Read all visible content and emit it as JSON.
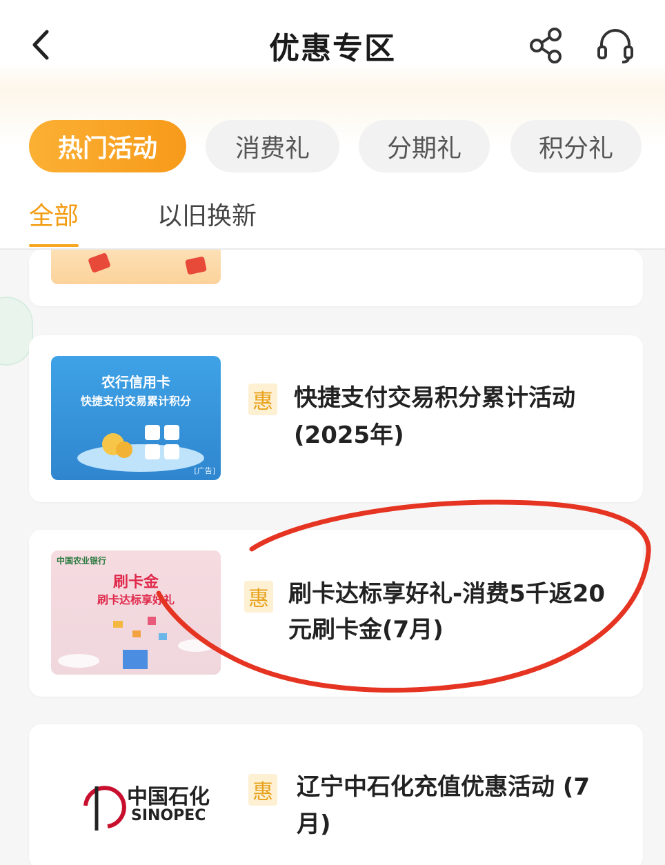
{
  "header": {
    "title": "优惠专区",
    "back_icon": "chevron-left-icon",
    "share_icon": "share-icon",
    "service_icon": "headset-icon"
  },
  "categories": [
    {
      "label": "热门活动",
      "active": true
    },
    {
      "label": "消费礼",
      "active": false
    },
    {
      "label": "分期礼",
      "active": false
    },
    {
      "label": "积分礼",
      "active": false
    }
  ],
  "sub_tabs": [
    {
      "label": "全部",
      "active": true
    },
    {
      "label": "以旧换新",
      "active": false
    }
  ],
  "activities": [
    {
      "badge": "惠",
      "title_line1": "快捷支付交易积分累计活动",
      "title_line2": "(2025年)",
      "thumb_text1": "农行信用卡",
      "thumb_text2": "快捷支付交易累计积分",
      "thumb_ad": "[广告]"
    },
    {
      "badge": "惠",
      "title_line1": "刷卡达标享好礼-消费5千返20",
      "title_line2": "元刷卡金(7月)",
      "thumb_logo": "中国农业银行",
      "thumb_text1": "刷卡金",
      "thumb_text2": "刷卡达标享好礼"
    },
    {
      "badge": "惠",
      "title_line1": "辽宁中石化充值优惠活动 (7",
      "title_line2": "月)",
      "thumb_cn": "中国石化",
      "thumb_en": "SINOPEC"
    }
  ],
  "colors": {
    "accent": "#f7a21c",
    "badge_bg": "#fdf0d3",
    "annotation": "#e53422"
  }
}
